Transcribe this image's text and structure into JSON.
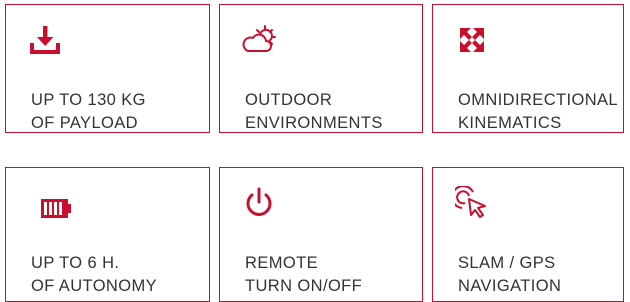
{
  "accent_color": "#c8102e",
  "features": [
    {
      "icon": "download-icon",
      "line1": "UP TO 130 KG",
      "line2": "OF PAYLOAD"
    },
    {
      "icon": "cloud-sun-icon",
      "line1": "OUTDOOR",
      "line2": "ENVIRONMENTS"
    },
    {
      "icon": "expand-arrows-icon",
      "line1": "OMNIDIRECTIONAL",
      "line2": "KINEMATICS"
    },
    {
      "icon": "battery-icon",
      "line1": "UP TO 6 H.",
      "line2": "OF AUTONOMY"
    },
    {
      "icon": "power-icon",
      "line1": "REMOTE",
      "line2": "TURN ON/OFF"
    },
    {
      "icon": "cursor-target-icon",
      "line1": "SLAM / GPS",
      "line2": "NAVIGATION"
    }
  ]
}
